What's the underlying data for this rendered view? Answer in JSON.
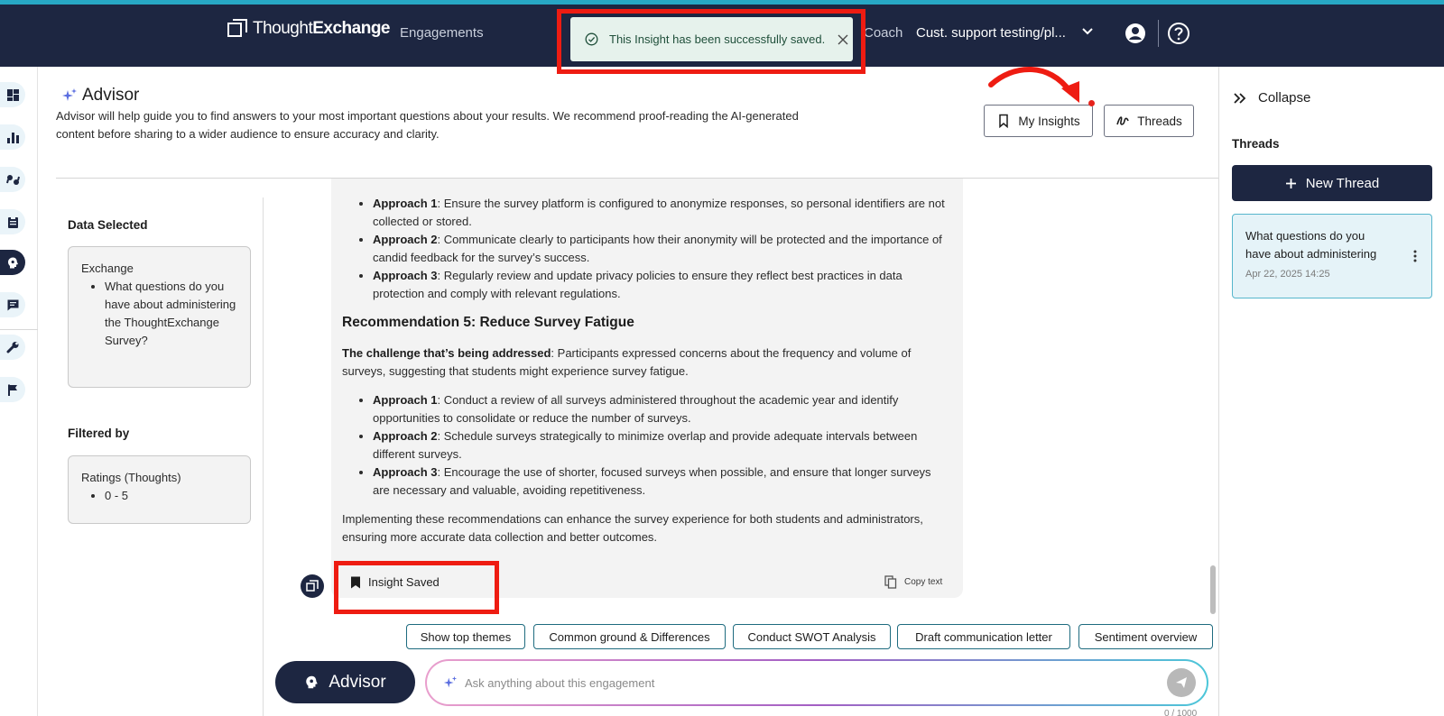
{
  "topbar": {
    "brand_regular": "Thought",
    "brand_bold": "Exchange",
    "nav_engagements": "Engagements",
    "nav_coach": "Coach",
    "project_name": "Cust. support testing/pl..."
  },
  "toast": {
    "message": "This Insight has been successfully saved."
  },
  "advisor": {
    "title": "Advisor",
    "description": "Advisor will help guide you to find answers to your most important questions about your results. We recommend proof-reading the AI-generated content before sharing to a wider audience to ensure accuracy and clarity.",
    "my_insights_label": "My Insights",
    "threads_label": "Threads"
  },
  "data_panel": {
    "data_selected_label": "Data Selected",
    "exchange_heading": "Exchange",
    "exchange_question": "What questions do you have about administering the ThoughtExchange Survey?",
    "filtered_by_label": "Filtered by",
    "filter_heading": "Ratings (Thoughts)",
    "filter_value": "0 - 5"
  },
  "message": {
    "rec4_approaches": [
      {
        "label": "Approach 1",
        "text": ": Ensure the survey platform is configured to anonymize responses, so personal identifiers are not collected or stored."
      },
      {
        "label": "Approach 2",
        "text": ": Communicate clearly to participants how their anonymity will be protected and the importance of candid feedback for the survey’s success."
      },
      {
        "label": "Approach 3",
        "text": ": Regularly review and update privacy policies to ensure they reflect best practices in data protection and comply with relevant regulations."
      }
    ],
    "rec5_title": "Recommendation 5: Reduce Survey Fatigue",
    "rec5_challenge_label": "The challenge that’s being addressed",
    "rec5_challenge_text": ": Participants expressed concerns about the frequency and volume of surveys, suggesting that students might experience survey fatigue.",
    "rec5_approaches": [
      {
        "label": "Approach 1",
        "text": ": Conduct a review of all surveys administered throughout the academic year and identify opportunities to consolidate or reduce the number of surveys."
      },
      {
        "label": "Approach 2",
        "text": ": Schedule surveys strategically to minimize overlap and provide adequate intervals between different surveys."
      },
      {
        "label": "Approach 3",
        "text": ": Encourage the use of shorter, focused surveys when possible, and ensure that longer surveys are necessary and valuable, avoiding repetitiveness."
      }
    ],
    "closing": "Implementing these recommendations can enhance the survey experience for both students and administrators, ensuring more accurate data collection and better outcomes.",
    "insight_saved_label": "Insight Saved",
    "copy_text_label": "Copy text"
  },
  "chips": [
    "Show top themes",
    "Common ground & Differences",
    "Conduct SWOT Analysis",
    "Draft communication letter",
    "Sentiment overview"
  ],
  "composer": {
    "advisor_button_label": "Advisor",
    "placeholder": "Ask anything about this engagement",
    "value": "",
    "char_count": "0 / 1000"
  },
  "sidebar": {
    "collapse_label": "Collapse",
    "threads_heading": "Threads",
    "new_thread_label": "New Thread",
    "thread": {
      "title": "What questions do you have about administering",
      "date": "Apr 22, 2025 14:25"
    }
  },
  "colors": {
    "navy": "#1d2641",
    "accent_teal": "#27a7c4",
    "highlight_red": "#ee1c12",
    "toast_bg": "#e6f2ec",
    "thread_card_bg": "#e5f3f8"
  },
  "icons": {
    "rail": [
      "dashboard-icon",
      "bar-chart-icon",
      "quotes-icon",
      "clipboard-icon",
      "advisor-icon",
      "chat-icon",
      "wrench-icon",
      "flag-icon"
    ]
  }
}
